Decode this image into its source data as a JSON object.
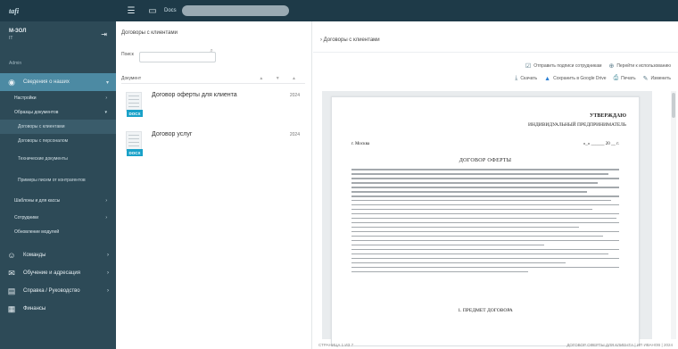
{
  "topbar": {
    "logo": "tafi",
    "menu_icon": "hamburger-icon",
    "view_icon": "window-icon",
    "label": "Docs"
  },
  "sidebar": {
    "user": {
      "name": "М-ЗОЛ",
      "sub": "IT",
      "role": "Admin"
    },
    "sections": [
      {
        "label": "Сведения о наших",
        "icon": "user-icon",
        "active": true
      },
      {
        "label": "Команды",
        "icon": "group-icon"
      },
      {
        "label": "Обучение и адресация",
        "icon": "chat-icon"
      },
      {
        "label": "Справка / Руководство",
        "icon": "book-icon"
      },
      {
        "label": "Финансы",
        "icon": "clipboard-icon"
      }
    ],
    "items": [
      {
        "label": "Настройки"
      },
      {
        "label": "Образцы документов"
      }
    ],
    "subitems": [
      {
        "label": "Договоры с клиентами",
        "selected": true
      },
      {
        "label": "Договоры с персоналом"
      },
      {
        "label": "Технические документы"
      },
      {
        "label": "Примеры писем от контрагентов"
      }
    ],
    "items2": [
      {
        "label": "Шаблоны и для кассы"
      },
      {
        "label": "Сотрудники"
      },
      {
        "label": "Обновление модулей"
      }
    ]
  },
  "middle": {
    "title": "Договоры с клиентами",
    "search_label": "Поиск",
    "search_placeholder": "",
    "list_header": "Документ",
    "sort_marks": "▲ ▼ ▲",
    "documents": [
      {
        "title": "Договор оферты для клиента",
        "date": "2024",
        "badge": "DOCX"
      },
      {
        "title": "Договор услуг",
        "date": "2024",
        "badge": "DOCX"
      }
    ]
  },
  "right": {
    "breadcrumb": "› Договоры с клиентами",
    "toolbar1": [
      {
        "label": "Отправить подписи сотрудникам",
        "icon": "checkbox-icon"
      },
      {
        "label": "Перейти к использованию",
        "icon": "link-icon"
      }
    ],
    "toolbar2": [
      {
        "label": "Скачать",
        "icon": "download-icon"
      },
      {
        "label": "Сохранить в Google Drive",
        "icon": "drive-icon"
      },
      {
        "label": "Печать",
        "icon": "print-icon"
      },
      {
        "label": "Изменить",
        "icon": "edit-icon"
      }
    ],
    "page": {
      "approve": "УТВЕРЖДАЮ",
      "ip": "ИНДИВИДУАЛЬНЫЙ ПРЕДПРИНИМАТЕЛЬ",
      "city": "г. Москва",
      "date": "«_» ______ 20 __ г.",
      "heading": "ДОГОВОР ОФЕРТЫ",
      "section1": "1. ПРЕДМЕТ ДОГОВОРА"
    },
    "footer_left": "СТРАНИЦА 1 ИЗ 7",
    "footer_right": "ДОГОВОР ОФЕРТЫ ДЛЯ КЛИЕНТА | ИП ИВАНОВ | 2024"
  }
}
